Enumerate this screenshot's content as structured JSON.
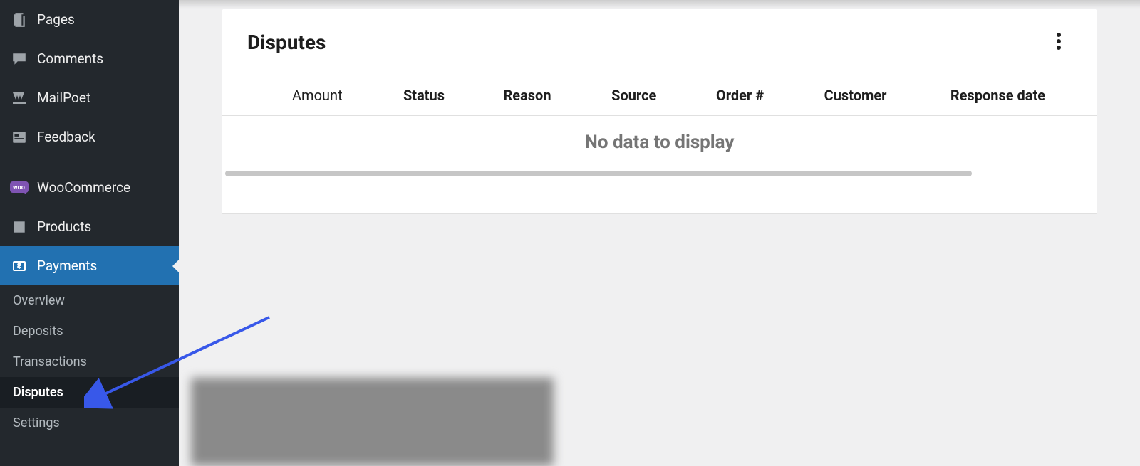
{
  "sidebar": {
    "items": [
      {
        "label": "Pages",
        "icon": "page-stack-icon"
      },
      {
        "label": "Comments",
        "icon": "comment-icon"
      },
      {
        "label": "MailPoet",
        "icon": "mailpoet-icon"
      },
      {
        "label": "Feedback",
        "icon": "feedback-icon"
      },
      {
        "label": "WooCommerce",
        "icon": "woo-icon"
      },
      {
        "label": "Products",
        "icon": "products-icon"
      },
      {
        "label": "Payments",
        "icon": "payments-icon",
        "active": true
      }
    ],
    "submenu": [
      {
        "label": "Overview"
      },
      {
        "label": "Deposits"
      },
      {
        "label": "Transactions"
      },
      {
        "label": "Disputes",
        "current": true
      },
      {
        "label": "Settings"
      }
    ]
  },
  "card": {
    "title": "Disputes",
    "columns": [
      "",
      "Amount",
      "Status",
      "Reason",
      "Source",
      "Order #",
      "Customer",
      "Response date"
    ],
    "empty_label": "No data to display"
  },
  "colors": {
    "accent": "#2271b1",
    "arrow": "#3858e9"
  }
}
